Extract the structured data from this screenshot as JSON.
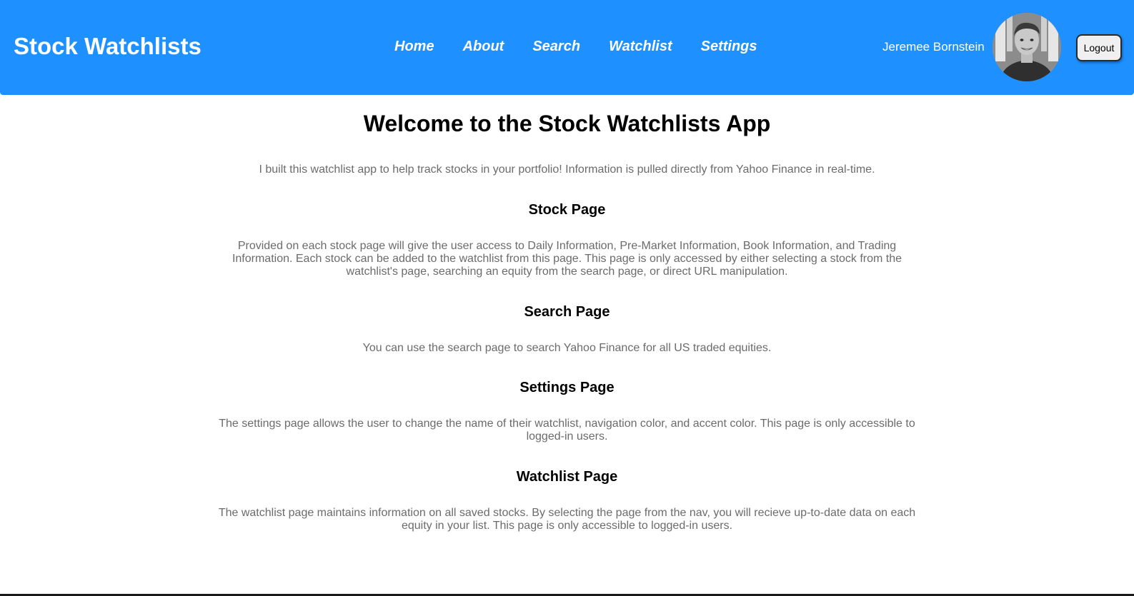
{
  "header": {
    "brand": "Stock Watchlists",
    "nav": [
      "Home",
      "About",
      "Search",
      "Watchlist",
      "Settings"
    ],
    "user_name": "Jeremee Bornstein",
    "logout_label": "Logout"
  },
  "main": {
    "title": "Welcome to the Stock Watchlists App",
    "intro": "I built this watchlist app to help track stocks in your portfolio! Information is pulled directly from Yahoo Finance in real-time.",
    "sections": [
      {
        "heading": "Stock Page",
        "text": "Provided on each stock page will give the user access to Daily Information, Pre-Market Information, Book Information, and Trading Information. Each stock can be added to the watchlist from this page. This page is only accessed by either selecting a stock from the watchlist's page, searching an equity from the search page, or direct URL manipulation."
      },
      {
        "heading": "Search Page",
        "text": "You can use the search page to search Yahoo Finance for all US traded equities."
      },
      {
        "heading": "Settings Page",
        "text": "The settings page allows the user to change the name of their watchlist, navigation color, and accent color. This page is only accessible to logged-in users."
      },
      {
        "heading": "Watchlist Page",
        "text": "The watchlist page maintains information on all saved stocks. By selecting the page from the nav, you will recieve up-to-date data on each equity in your list. This page is only accessible to logged-in users."
      }
    ]
  },
  "colors": {
    "nav_background": "#1e90ff",
    "body_text": "#6b6b6b",
    "heading_text": "#000000"
  }
}
